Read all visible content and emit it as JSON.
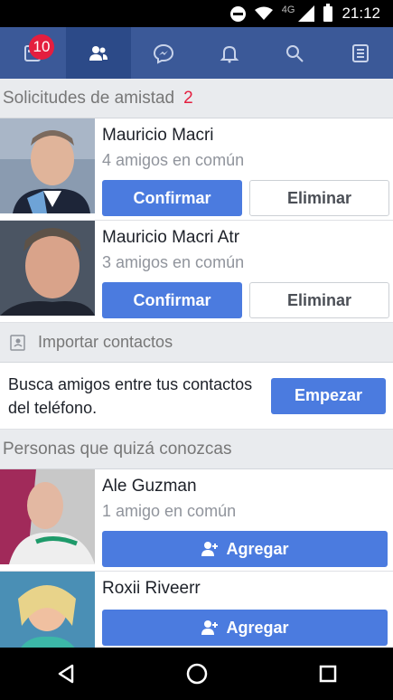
{
  "status_bar": {
    "network": "4G",
    "time": "21:12"
  },
  "nav": {
    "badge_count": "10",
    "tabs": [
      {
        "icon": "news-feed-icon"
      },
      {
        "icon": "friends-icon"
      },
      {
        "icon": "messenger-icon"
      },
      {
        "icon": "bell-icon"
      },
      {
        "icon": "search-icon"
      },
      {
        "icon": "menu-icon"
      }
    ]
  },
  "requests": {
    "title": "Solicitudes de amistad",
    "count": "2",
    "items": [
      {
        "name": "Mauricio Macri",
        "mutual": "4 amigos en común",
        "confirm": "Confirmar",
        "delete": "Eliminar"
      },
      {
        "name": "Mauricio Macri Atr",
        "mutual": "3 amigos en común",
        "confirm": "Confirmar",
        "delete": "Eliminar"
      }
    ]
  },
  "import": {
    "title": "Importar contactos",
    "text": "Busca amigos entre tus contactos del teléfono.",
    "button": "Empezar"
  },
  "suggestions": {
    "title": "Personas que quizá conozcas",
    "items": [
      {
        "name": "Ale Guzman",
        "mutual": "1 amigo en común",
        "add": "Agregar"
      },
      {
        "name": "Roxii Riveerr",
        "mutual": "",
        "add": "Agregar"
      }
    ]
  },
  "colors": {
    "brand": "#3b5998",
    "primary_button": "#4b7bdf",
    "badge": "#e41e3f"
  }
}
